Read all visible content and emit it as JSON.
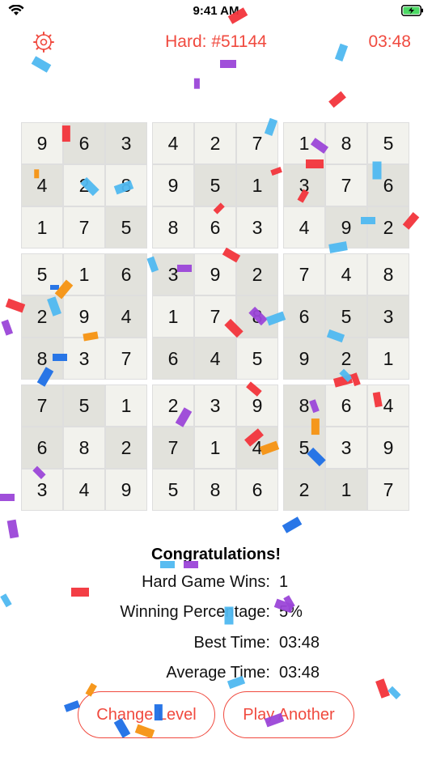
{
  "status_bar": {
    "time": "9:41 AM"
  },
  "header": {
    "title": "Hard: #51144",
    "timer": "03:48",
    "accent_color": "#f04a3f",
    "settings_icon": "gear-icon"
  },
  "board": {
    "rows": [
      [
        "9",
        "6",
        "3",
        "4",
        "2",
        "7",
        "1",
        "8",
        "5"
      ],
      [
        "4",
        "2",
        "8",
        "9",
        "5",
        "1",
        "3",
        "7",
        "6"
      ],
      [
        "1",
        "7",
        "5",
        "8",
        "6",
        "3",
        "4",
        "9",
        "2"
      ],
      [
        "5",
        "1",
        "6",
        "3",
        "9",
        "2",
        "7",
        "4",
        "8"
      ],
      [
        "2",
        "9",
        "4",
        "1",
        "7",
        "8",
        "6",
        "5",
        "3"
      ],
      [
        "8",
        "3",
        "7",
        "6",
        "4",
        "5",
        "9",
        "2",
        "1"
      ],
      [
        "7",
        "5",
        "1",
        "2",
        "3",
        "9",
        "8",
        "6",
        "4"
      ],
      [
        "6",
        "8",
        "2",
        "7",
        "1",
        "4",
        "5",
        "3",
        "9"
      ],
      [
        "3",
        "4",
        "9",
        "5",
        "8",
        "6",
        "2",
        "1",
        "7"
      ]
    ],
    "shaded": [
      [
        0,
        1
      ],
      [
        0,
        2
      ],
      [
        1,
        0
      ],
      [
        1,
        4
      ],
      [
        1,
        5
      ],
      [
        1,
        6
      ],
      [
        1,
        8
      ],
      [
        2,
        2
      ],
      [
        2,
        7
      ],
      [
        2,
        8
      ],
      [
        3,
        2
      ],
      [
        3,
        3
      ],
      [
        3,
        5
      ],
      [
        4,
        0
      ],
      [
        4,
        2
      ],
      [
        4,
        5
      ],
      [
        4,
        6
      ],
      [
        4,
        7
      ],
      [
        4,
        8
      ],
      [
        5,
        0
      ],
      [
        5,
        3
      ],
      [
        5,
        4
      ],
      [
        5,
        6
      ],
      [
        5,
        7
      ],
      [
        6,
        0
      ],
      [
        6,
        1
      ],
      [
        6,
        6
      ],
      [
        7,
        0
      ],
      [
        7,
        2
      ],
      [
        7,
        3
      ],
      [
        7,
        5
      ],
      [
        7,
        6
      ],
      [
        8,
        6
      ],
      [
        8,
        7
      ]
    ]
  },
  "results": {
    "heading": "Congratulations!",
    "stats": [
      {
        "label": "Hard Game Wins:",
        "value": "1"
      },
      {
        "label": "Winning Percentage:",
        "value": "5%"
      },
      {
        "label": "Best Time:",
        "value": "03:48"
      },
      {
        "label": "Average Time:",
        "value": "03:48"
      }
    ]
  },
  "buttons": {
    "change_level": "Change Level",
    "play_another": "Play Another"
  },
  "confetti_colors": [
    "#f2343b",
    "#4fb8f0",
    "#9b46d8",
    "#f59211",
    "#1e6fe6"
  ]
}
